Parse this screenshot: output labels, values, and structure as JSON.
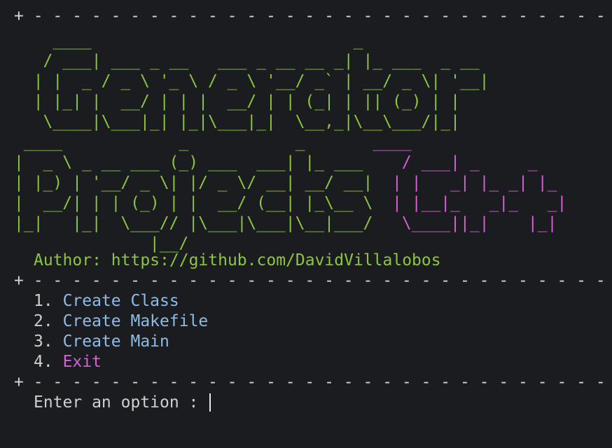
{
  "terminal": {
    "border": "+ - - - - - - - - - - - - - - - - - - - - - - - - - - - - - - +",
    "banner_lines": [
      {
        "green": "    ____                           _",
        "magenta": ""
      },
      {
        "green": "   / ___| ___ _ __   ___ _ __ __ _| |_ ___  _ __",
        "magenta": ""
      },
      {
        "green": "  | |  _ / _ \\ '_ \\ / _ \\ '__/ _` | __/ _ \\| '__|",
        "magenta": ""
      },
      {
        "green": "  | |_| |  __/ | | |  __/ | | (_| | || (_) | |",
        "magenta": ""
      },
      {
        "green": "   \\____|\\___|_| |_|\\___|_|  \\__,_|\\__\\___/|_|",
        "magenta": ""
      },
      {
        "green": " ____            _           _",
        "magenta": "       ____"
      },
      {
        "green": "|  _ \\ _ __ ___ (_) ___  ___| |_ ___",
        "magenta": "    / ___| _     _"
      },
      {
        "green": "| |_) | '__/ _ \\| |/ _ \\/ __| __/ __|",
        "magenta": "  | |   _| |_ _| |_"
      },
      {
        "green": "|  __/| | | (_) | |  __/ (__| |_\\__ \\",
        "magenta": "  | |__|_   _|_   _|"
      },
      {
        "green": "|_|   |_|  \\___// |\\___|\\___|\\__|___/",
        "magenta": "   \\____||_|    |_|"
      },
      {
        "green": "              |__/",
        "magenta": ""
      }
    ],
    "author_label": "Author:",
    "author_url": "https://github.com/DavidVillalobos",
    "menu": [
      {
        "number": "1.",
        "label": "Create Class",
        "color": "#8fbbe6"
      },
      {
        "number": "2.",
        "label": "Create Makefile",
        "color": "#8fbbe6"
      },
      {
        "number": "3.",
        "label": "Create Main",
        "color": "#8fbbe6"
      },
      {
        "number": "4.",
        "label": "Exit",
        "color": "#d75fd7"
      }
    ],
    "prompt": "Enter an option : ",
    "colors": {
      "background": "#1b1c1f",
      "green": "#8cc63f",
      "magenta": "#d75fd7",
      "blue": "#8fbbe6",
      "text": "#d4d4d4"
    }
  }
}
